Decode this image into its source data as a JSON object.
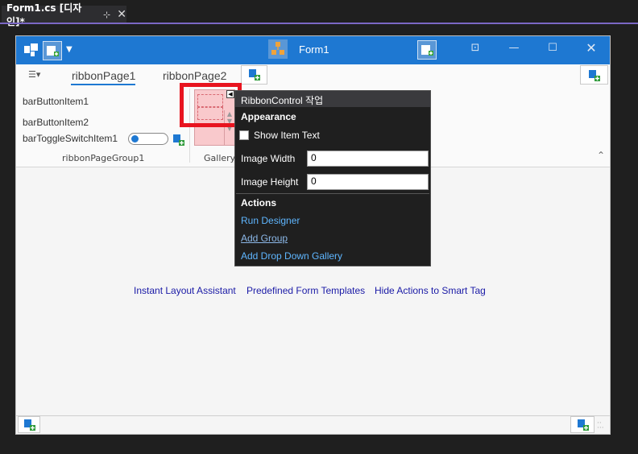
{
  "document_tab": {
    "title": "Form1.cs [디자인]*",
    "pin_glyph": "⊹",
    "close_glyph": "✕"
  },
  "form": {
    "title": "Form1",
    "accent": "#1e78d2"
  },
  "window_buttons": {
    "restore": "⊡",
    "minimize": "—",
    "maximize": "☐",
    "close": "✕"
  },
  "ribbon": {
    "tabs": [
      {
        "label": "ribbonPage1",
        "selected": true
      },
      {
        "label": "ribbonPage2",
        "selected": false
      }
    ],
    "items": {
      "button1": "barButtonItem1",
      "button2": "barButtonItem2",
      "toggle": "barToggleSwitchItem1"
    },
    "group_label": "ribbonPageGroup1",
    "gallery_label": "Gallery"
  },
  "smart_tag_panel": {
    "title": "RibbonControl 작업",
    "appearance_header": "Appearance",
    "show_item_text_label": "Show Item Text",
    "show_item_text_checked": false,
    "image_width_label": "Image Width",
    "image_width_value": "0",
    "image_height_label": "Image Height",
    "image_height_value": "0",
    "actions_header": "Actions",
    "actions": {
      "run_designer": "Run Designer",
      "add_group": "Add Group",
      "add_drop_down_gallery": "Add Drop Down Gallery"
    }
  },
  "client_links": {
    "instant_layout": "Instant Layout Assistant",
    "predefined_templates": "Predefined Form Templates",
    "hide_actions": "Hide Actions to Smart Tag"
  },
  "highlight_color": "#e8141f"
}
